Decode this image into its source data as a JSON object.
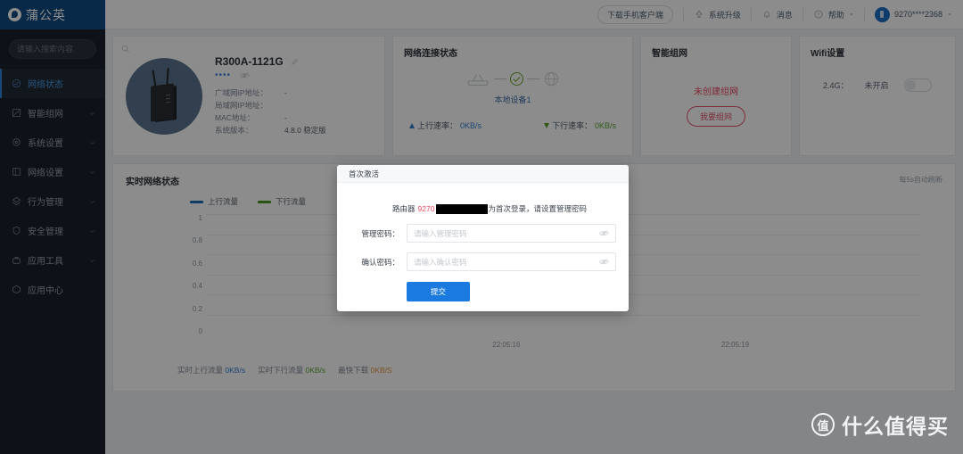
{
  "sidebar": {
    "logo_text": "蒲公英",
    "search_placeholder": "请输入搜索内容",
    "items": [
      {
        "label": "网络状态",
        "icon": "network-status-icon",
        "active": true,
        "caret": false
      },
      {
        "label": "智能组网",
        "icon": "mesh-icon",
        "active": false,
        "caret": true
      },
      {
        "label": "系统设置",
        "icon": "gear-icon",
        "active": false,
        "caret": true
      },
      {
        "label": "网络设置",
        "icon": "network-settings-icon",
        "active": false,
        "caret": true
      },
      {
        "label": "行为管理",
        "icon": "behavior-icon",
        "active": false,
        "caret": true
      },
      {
        "label": "安全管理",
        "icon": "shield-icon",
        "active": false,
        "caret": true
      },
      {
        "label": "应用工具",
        "icon": "toolbox-icon",
        "active": false,
        "caret": true
      },
      {
        "label": "应用中心",
        "icon": "app-center-icon",
        "active": false,
        "caret": false
      }
    ]
  },
  "header": {
    "download_app": "下载手机客户端",
    "system_upgrade": "系统升级",
    "messages": "消息",
    "help": "帮助",
    "account": "9270****2368"
  },
  "device_card": {
    "name": "R300A-1121G",
    "password_mask": "••••",
    "rows": [
      {
        "key": "广域网IP地址：",
        "value": "-"
      },
      {
        "key": "局域网IP地址：",
        "value": ""
      },
      {
        "key": "MAC地址：",
        "value": "-"
      },
      {
        "key": "系统版本：",
        "value": "4.8.0 稳定版"
      }
    ]
  },
  "connection_card": {
    "title": "网络连接状态",
    "device_label": "本地设备1",
    "upload_label": "上行速率：",
    "upload_value": "0KB/s",
    "download_label": "下行速率：",
    "download_value": "0KB/s"
  },
  "mesh_card": {
    "title": "智能组网",
    "message": "未创建组网",
    "button": "我要组网"
  },
  "wifi_card": {
    "title": "Wifi设置",
    "band": "2.4G：",
    "state": "未开启",
    "toggle_on": false
  },
  "chart_panel": {
    "title": "实时网络状态",
    "refresh_note": "每5s自动刷新",
    "footer": [
      {
        "label": "实时上行流量",
        "value": "0KB/s"
      },
      {
        "label": "实时下行流量",
        "value": "0KB/s"
      },
      {
        "label": "最快下载",
        "value": "0KB/S"
      }
    ]
  },
  "chart_data": {
    "type": "line",
    "title": "实时网络状态",
    "xlabel": "",
    "ylabel": "",
    "grid": true,
    "legend_position": "top-left",
    "ylim": [
      0,
      1
    ],
    "yticks": [
      "1",
      "0.8",
      "0.6",
      "0.4",
      "0.2",
      "0"
    ],
    "x": [
      "22:05:16",
      "22:05:19"
    ],
    "xticks": [
      "22:05:16",
      "22:05:19"
    ],
    "series": [
      {
        "name": "上行流量",
        "color": "#1f6fb8",
        "values": [
          0,
          0
        ]
      },
      {
        "name": "下行流量",
        "color": "#4f9b23",
        "values": [
          0,
          0
        ]
      }
    ]
  },
  "modal": {
    "title": "首次激活",
    "msg_prefix": "路由器 ",
    "msg_id": "9270",
    "msg_suffix": "为首次登录，请设置管理密码",
    "password_label": "管理密码：",
    "password_placeholder": "请输入管理密码",
    "password_value": "",
    "confirm_label": "确认密码：",
    "confirm_placeholder": "请输入确认密码",
    "confirm_value": "",
    "submit": "提交"
  },
  "watermark": {
    "badge": "值",
    "text": "什么值得买"
  },
  "colors": {
    "brand_blue": "#0f4c81",
    "accent_blue": "#1a7ae0",
    "upload_blue": "#2f7fd1",
    "download_green": "#5aa531",
    "warn_red": "#e8485f"
  }
}
